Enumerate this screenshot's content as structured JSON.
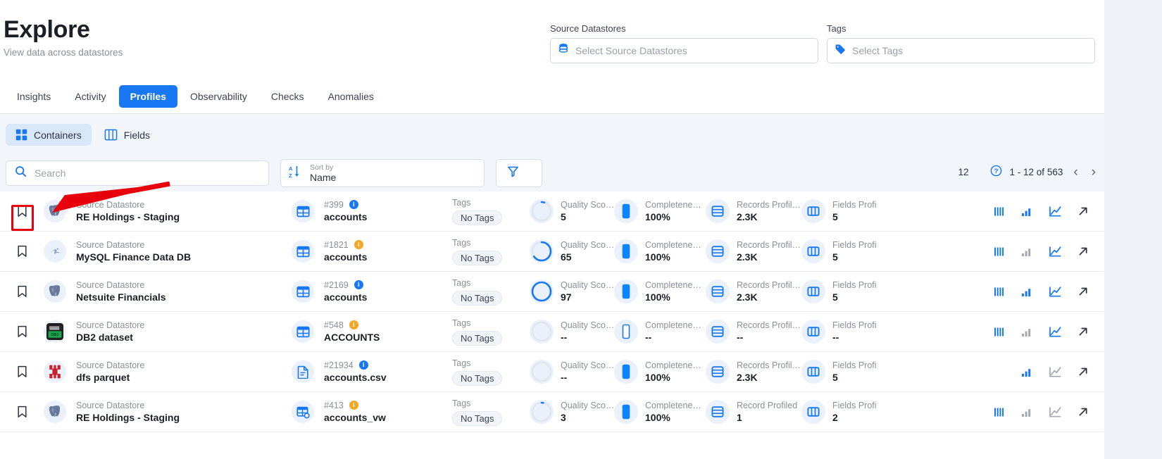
{
  "header": {
    "title": "Explore",
    "subtitle": "View data across datastores",
    "source_datastores_label": "Source Datastores",
    "source_datastores_placeholder": "Select Source Datastores",
    "tags_label": "Tags",
    "tags_placeholder": "Select Tags"
  },
  "tabs": [
    {
      "label": "Insights",
      "active": false
    },
    {
      "label": "Activity",
      "active": false
    },
    {
      "label": "Profiles",
      "active": true
    },
    {
      "label": "Observability",
      "active": false
    },
    {
      "label": "Checks",
      "active": false
    },
    {
      "label": "Anomalies",
      "active": false
    }
  ],
  "view_toggle": [
    {
      "label": "Containers",
      "icon": "grid-icon",
      "active": true
    },
    {
      "label": "Fields",
      "icon": "columns-icon",
      "active": false
    }
  ],
  "toolbar": {
    "search_placeholder": "Search",
    "search_value": "",
    "sort_caption": "Sort by",
    "sort_value": "Name",
    "filter_icon": "funnel-icon"
  },
  "pagination": {
    "page_size": "12",
    "range": "1 - 12 of 563",
    "prev_icon": "chevron-left-icon",
    "next_icon": "chevron-right-icon",
    "help_icon": "help-circle-icon"
  },
  "columns": {
    "store_caption": "Source Datastore",
    "tags_caption": "Tags",
    "quality_caption": "Quality Sco…",
    "completeness_caption": "Completene…",
    "records_caption": "Records Profil…",
    "fields_caption": "Fields Profi"
  },
  "rows": [
    {
      "bookmark_icon": "bookmark-icon",
      "store_logo": "postgresql-logo",
      "store_caption": "Source Datastore",
      "store_name": "RE Holdings - Staging",
      "asset_icon": "table-icon",
      "asset_id": "#399",
      "info_badge": "blue",
      "asset_name": "accounts",
      "tags_caption": "Tags",
      "tags_value": "No Tags",
      "quality_caption": "Quality Sco…",
      "quality_value": "5",
      "quality_pct": 5,
      "completeness_caption": "Completene…",
      "completeness_value": "100%",
      "completeness_pct": 100,
      "records_caption": "Records Profil…",
      "records_value": "2.3K",
      "fields_caption": "Fields Profi",
      "fields_value": "5",
      "actions": {
        "histogram": "on",
        "bars": "on",
        "line": "on",
        "open": "on"
      }
    },
    {
      "bookmark_icon": "bookmark-icon",
      "store_logo": "mysql-logo",
      "store_caption": "Source Datastore",
      "store_name": "MySQL Finance Data DB",
      "asset_icon": "table-icon",
      "asset_id": "#1821",
      "info_badge": "amber",
      "asset_name": "accounts",
      "tags_caption": "Tags",
      "tags_value": "No Tags",
      "quality_caption": "Quality Sco…",
      "quality_value": "65",
      "quality_pct": 65,
      "completeness_caption": "Completene…",
      "completeness_value": "100%",
      "completeness_pct": 100,
      "records_caption": "Records Profil…",
      "records_value": "2.3K",
      "fields_caption": "Fields Profi",
      "fields_value": "5",
      "actions": {
        "histogram": "on",
        "bars": "off",
        "line": "on",
        "open": "on"
      }
    },
    {
      "bookmark_icon": "bookmark-icon",
      "store_logo": "postgresql-logo",
      "store_caption": "Source Datastore",
      "store_name": "Netsuite Financials",
      "asset_icon": "table-icon",
      "asset_id": "#2169",
      "info_badge": "blue",
      "asset_name": "accounts",
      "tags_caption": "Tags",
      "tags_value": "No Tags",
      "quality_caption": "Quality Sco…",
      "quality_value": "97",
      "quality_pct": 97,
      "completeness_caption": "Completene…",
      "completeness_value": "100%",
      "completeness_pct": 100,
      "records_caption": "Records Profil…",
      "records_value": "2.3K",
      "fields_caption": "Fields Profi",
      "fields_value": "5",
      "actions": {
        "histogram": "on",
        "bars": "on",
        "line": "on",
        "open": "on"
      }
    },
    {
      "bookmark_icon": "bookmark-icon",
      "store_logo": "db2-logo",
      "store_caption": "Source Datastore",
      "store_name": "DB2 dataset",
      "asset_icon": "table-icon",
      "asset_id": "#548",
      "info_badge": "amber",
      "asset_name": "ACCOUNTS",
      "tags_caption": "Tags",
      "tags_value": "No Tags",
      "quality_caption": "Quality Sco…",
      "quality_value": "--",
      "quality_pct": 0,
      "completeness_caption": "Completene…",
      "completeness_value": "--",
      "completeness_pct": 0,
      "records_caption": "Records Profil…",
      "records_value": "--",
      "fields_caption": "Fields Profi",
      "fields_value": "--",
      "actions": {
        "histogram": "on",
        "bars": "off",
        "line": "on",
        "open": "on"
      }
    },
    {
      "bookmark_icon": "bookmark-icon",
      "store_logo": "parquet-logo",
      "store_caption": "Source Datastore",
      "store_name": "dfs parquet",
      "asset_icon": "file-icon",
      "asset_id": "#21934",
      "info_badge": "blue",
      "asset_name": "accounts.csv",
      "tags_caption": "Tags",
      "tags_value": "No Tags",
      "quality_caption": "Quality Sco…",
      "quality_value": "--",
      "quality_pct": 0,
      "completeness_caption": "Completene…",
      "completeness_value": "100%",
      "completeness_pct": 100,
      "records_caption": "Records Profil…",
      "records_value": "2.3K",
      "fields_caption": "Fields Profi",
      "fields_value": "5",
      "actions": {
        "histogram": "hidden",
        "bars": "on",
        "line": "off",
        "open": "on"
      }
    },
    {
      "bookmark_icon": "bookmark-icon",
      "store_logo": "postgresql-logo",
      "store_caption": "Source Datastore",
      "store_name": "RE Holdings - Staging",
      "asset_icon": "view-icon",
      "asset_id": "#413",
      "info_badge": "amber",
      "asset_name": "accounts_vw",
      "tags_caption": "Tags",
      "tags_value": "No Tags",
      "quality_caption": "Quality Sco…",
      "quality_value": "3",
      "quality_pct": 3,
      "completeness_caption": "Completene…",
      "completeness_value": "100%",
      "completeness_pct": 100,
      "records_caption": "Record Profiled",
      "records_value": "1",
      "fields_caption": "Fields Profi",
      "fields_value": "2",
      "actions": {
        "histogram": "on",
        "bars": "off",
        "line": "off",
        "open": "on"
      }
    }
  ],
  "annotation": {
    "highlight_color": "#e8000d",
    "target": "bookmark-icon-row-1"
  },
  "colors": {
    "accent": "#1878f3",
    "amber": "#f5a623",
    "panel_bg": "#f2f6fa",
    "page_bg": "#eef2f7"
  }
}
